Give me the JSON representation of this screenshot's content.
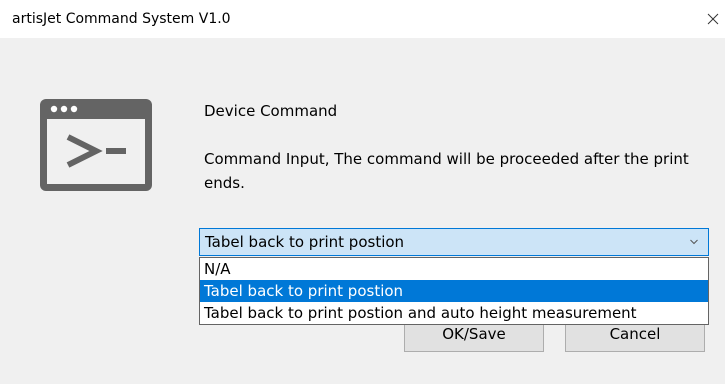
{
  "window": {
    "title": "artisJet Command System V1.0",
    "close_icon": "close-icon"
  },
  "content": {
    "icon": "console-window-icon",
    "heading": "Device Command",
    "description": "Command Input, The command will be proceeded after the print ends."
  },
  "command_select": {
    "selected": "Tabel back to print postion",
    "arrow_icon": "chevron-down-icon",
    "options": [
      "N/A",
      "Tabel back to print postion",
      "Tabel back to print postion and auto height measurement"
    ],
    "highlighted_index": 1
  },
  "buttons": {
    "ok_label": "OK/Save",
    "cancel_label": "Cancel"
  },
  "colors": {
    "accent": "#0078d7",
    "select_background": "#cce4f7",
    "dialog_background": "#f0f0f0",
    "icon_color": "#646464"
  }
}
